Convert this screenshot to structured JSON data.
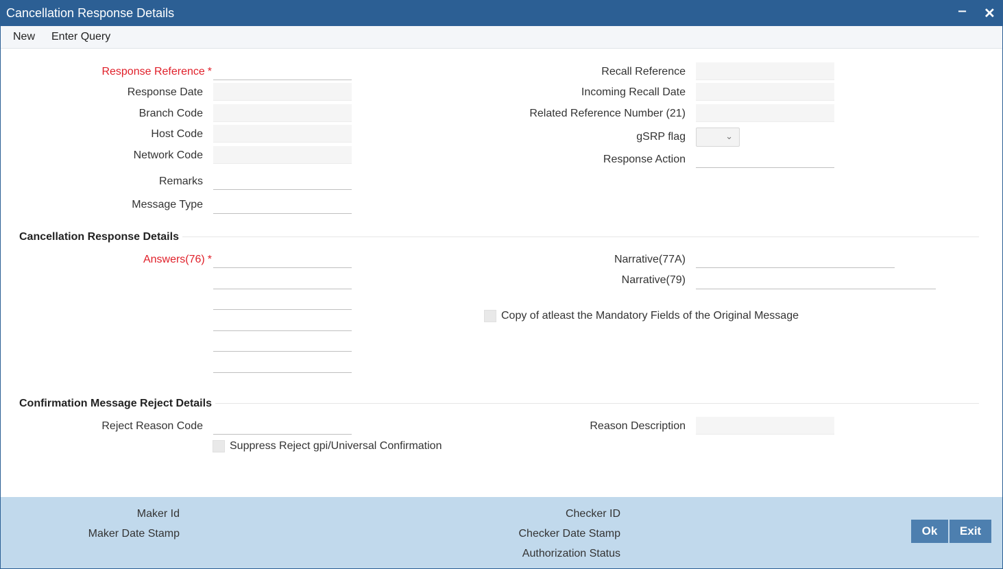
{
  "window": {
    "title": "Cancellation Response Details",
    "minimize_glyph": "‒",
    "close_glyph": "✕"
  },
  "toolbar": {
    "new_label": "New",
    "enter_query_label": "Enter Query"
  },
  "main": {
    "response_reference": {
      "label": "Response Reference",
      "required_mark": "*",
      "value": ""
    },
    "response_date": {
      "label": "Response Date",
      "value": ""
    },
    "branch_code": {
      "label": "Branch Code",
      "value": ""
    },
    "host_code": {
      "label": "Host Code",
      "value": ""
    },
    "network_code": {
      "label": "Network Code",
      "value": ""
    },
    "remarks": {
      "label": "Remarks",
      "value": ""
    },
    "message_type": {
      "label": "Message Type",
      "value": ""
    },
    "recall_reference": {
      "label": "Recall Reference",
      "value": ""
    },
    "incoming_recall_date": {
      "label": "Incoming Recall Date",
      "value": ""
    },
    "related_reference_number": {
      "label": "Related Reference Number (21)",
      "value": ""
    },
    "gsrp_flag": {
      "label": "gSRP flag",
      "value": ""
    },
    "response_action": {
      "label": "Response Action",
      "value": ""
    }
  },
  "cancellation_section": {
    "title": "Cancellation Response Details",
    "answers": {
      "label": "Answers(76)",
      "required_mark": "*",
      "lines": [
        "",
        "",
        "",
        "",
        "",
        ""
      ]
    },
    "narrative_77a": {
      "label": "Narrative(77A)",
      "value": ""
    },
    "narrative_79": {
      "label": "Narrative(79)",
      "value": ""
    },
    "copy_mandatory": {
      "label": "Copy of atleast the Mandatory Fields of the Original Message",
      "checked": false
    }
  },
  "reject_section": {
    "title": "Confirmation Message Reject Details",
    "reject_reason_code": {
      "label": "Reject Reason Code",
      "value": ""
    },
    "reason_description": {
      "label": "Reason Description",
      "value": ""
    },
    "suppress_reject": {
      "label": "Suppress Reject gpi/Universal Confirmation",
      "checked": false
    }
  },
  "footer": {
    "maker_id_label": "Maker Id",
    "maker_date_stamp_label": "Maker Date Stamp",
    "checker_id_label": "Checker ID",
    "checker_date_stamp_label": "Checker Date Stamp",
    "authorization_status_label": "Authorization Status",
    "ok_label": "Ok",
    "exit_label": "Exit"
  },
  "colors": {
    "titlebar": "#2c5f94",
    "required": "#e0202a",
    "footer": "#c1d9ec",
    "button": "#4d7faf"
  }
}
